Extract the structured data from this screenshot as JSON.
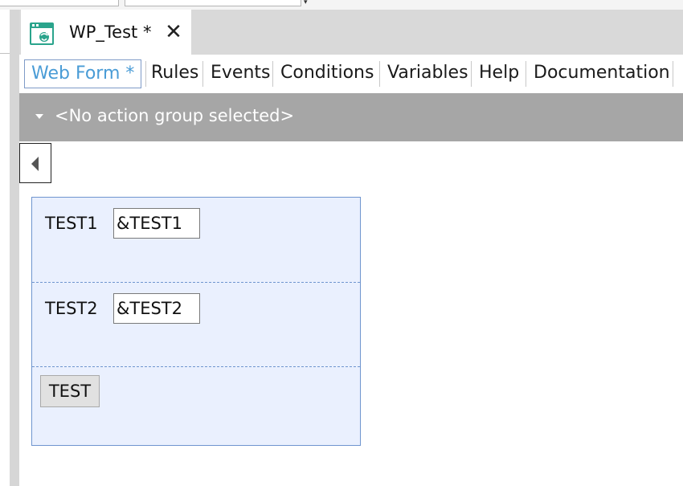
{
  "colors": {
    "accent": "#4a9cd6",
    "action_bar": "#a6a6a6",
    "form_background": "#eaf0fe",
    "form_border": "#6f95cf"
  },
  "document_tab": {
    "title": "WP_Test *",
    "icon": "web-panel-icon",
    "close_icon": "close-icon",
    "close_glyph": "✕"
  },
  "view_tabs": [
    {
      "label": "Web Form *",
      "active": true
    },
    {
      "label": "Rules",
      "active": false
    },
    {
      "label": "Events",
      "active": false
    },
    {
      "label": "Conditions",
      "active": false
    },
    {
      "label": "Variables",
      "active": false
    },
    {
      "label": "Help",
      "active": false
    },
    {
      "label": "Documentation",
      "active": false
    }
  ],
  "action_group": {
    "label": "<No action group selected>",
    "icon": "caret-down-icon"
  },
  "collapse_button": {
    "icon": "triangle-left-icon"
  },
  "form": {
    "rows": [
      {
        "label": "TEST1",
        "value": "&TEST1"
      },
      {
        "label": "TEST2",
        "value": "&TEST2"
      }
    ],
    "button_label": "TEST"
  }
}
